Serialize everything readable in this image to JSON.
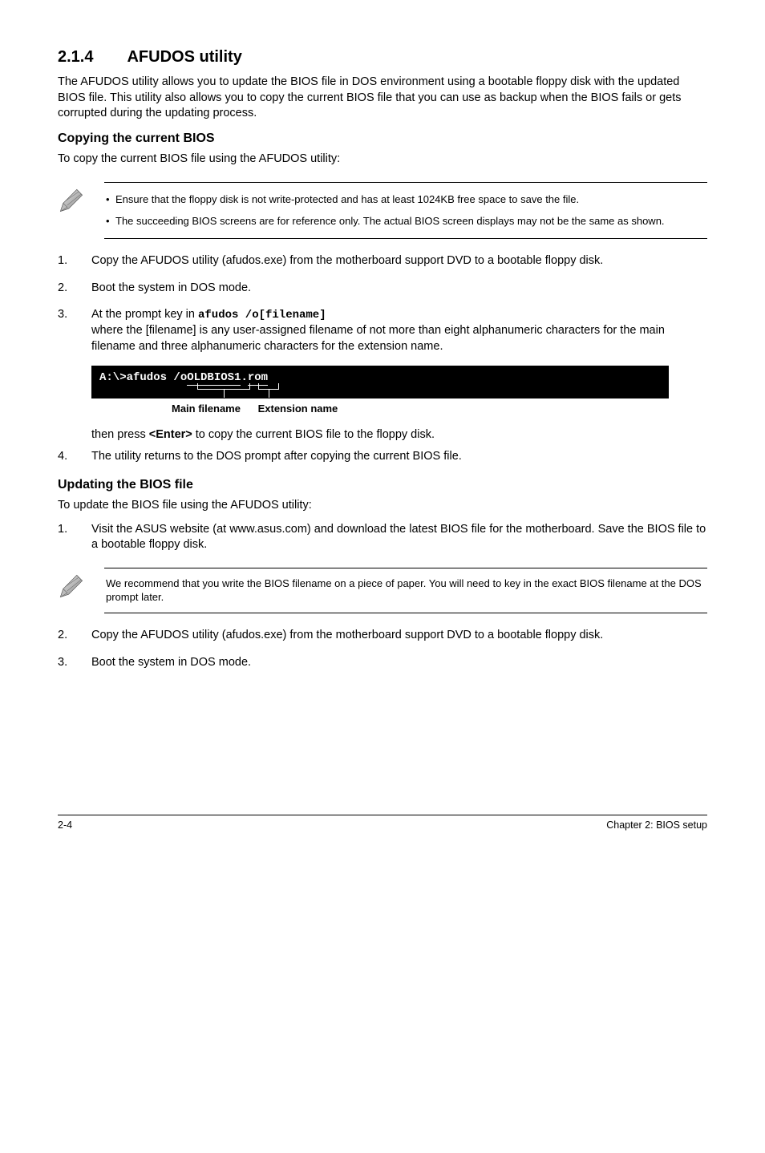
{
  "section": {
    "number": "2.1.4",
    "title": "AFUDOS utility"
  },
  "intro": "The AFUDOS utility allows you to update the BIOS file in DOS environment using a bootable floppy disk with the updated BIOS file. This utility also allows you to copy the current BIOS file that you can use as backup when the BIOS fails or gets corrupted during the updating process.",
  "copy_head": "Copying the current BIOS",
  "copy_lead": "To copy the current BIOS file using the AFUDOS utility:",
  "note1": {
    "a": "Ensure that the floppy disk is not write-protected and has at least 1024KB free space to save the file.",
    "b": "The succeeding BIOS screens are for reference only. The actual BIOS screen displays may not be the same as shown."
  },
  "steps_a": {
    "s1": "Copy the AFUDOS utility (afudos.exe) from the motherboard support DVD to a bootable floppy disk.",
    "s2": "Boot the system in DOS mode.",
    "s3_pre": "At the prompt key in ",
    "s3_code": "afudos /o[filename]",
    "s3_body": "where the [filename] is any user-assigned filename of not more than eight alphanumeric characters for the main filename and three alphanumeric characters for the extension name."
  },
  "terminal": {
    "prefix": "A:\\>afudos /o",
    "file": "OLDBIOS1",
    "dot": ".",
    "ext": "rom",
    "label1": "Main filename",
    "label2": "Extension name"
  },
  "after_term": {
    "press_pre": "then press ",
    "press_key": "<Enter>",
    "press_post": " to copy the current BIOS file to the floppy disk.",
    "s4": "The utility returns to the DOS prompt after copying the current BIOS file."
  },
  "upd_head": "Updating the BIOS file",
  "upd_lead": "To update the BIOS file using the AFUDOS utility:",
  "steps_b": {
    "s1": "Visit the ASUS website (at www.asus.com) and download the latest BIOS file for the motherboard. Save the BIOS file to a bootable floppy disk."
  },
  "note2": "We recommend that you write the BIOS filename on a piece of paper. You will need to key in the exact BIOS filename at the DOS prompt later.",
  "steps_c": {
    "s2": "Copy the AFUDOS utility (afudos.exe) from the motherboard support DVD to a bootable floppy disk.",
    "s3": "Boot the system in DOS mode."
  },
  "footer": {
    "left": "2-4",
    "right": "Chapter 2: BIOS setup"
  }
}
